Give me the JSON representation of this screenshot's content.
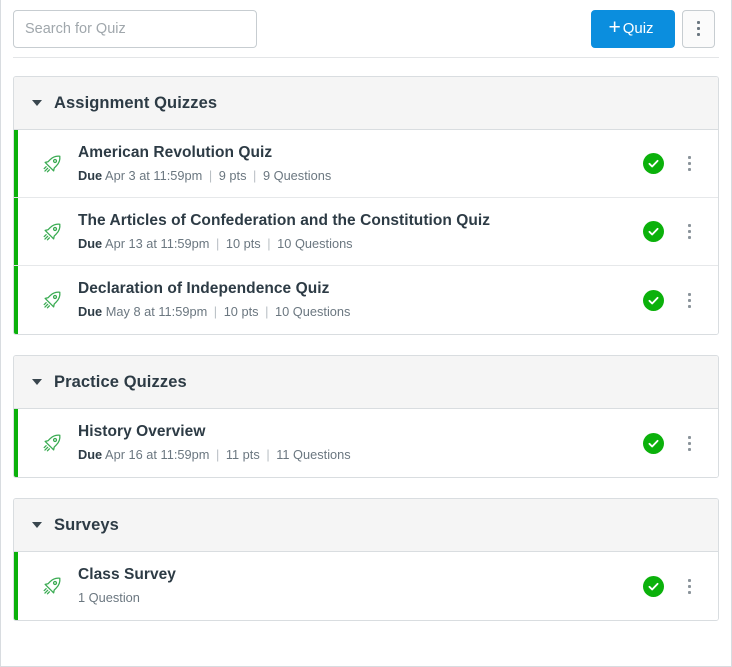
{
  "toolbar": {
    "search_placeholder": "Search for Quiz",
    "search_value": "",
    "add_quiz_label": "Quiz",
    "add_quiz_plus": "+",
    "kebab_name": "more-options"
  },
  "groups": [
    {
      "title": "Assignment Quizzes",
      "rows": [
        {
          "title": "American Revolution Quiz",
          "due_label": "Due",
          "due_value": "Apr 3 at 11:59pm",
          "points": "9 pts",
          "questions": "9 Questions",
          "published": true
        },
        {
          "title": "The Articles of Confederation and the Constitution Quiz",
          "due_label": "Due",
          "due_value": "Apr 13 at 11:59pm",
          "points": "10 pts",
          "questions": "10 Questions",
          "published": true
        },
        {
          "title": "Declaration of Independence Quiz",
          "due_label": "Due",
          "due_value": "May 8 at 11:59pm",
          "points": "10 pts",
          "questions": "10 Questions",
          "published": true
        }
      ]
    },
    {
      "title": "Practice Quizzes",
      "rows": [
        {
          "title": "History Overview",
          "due_label": "Due",
          "due_value": "Apr 16 at 11:59pm",
          "points": "11 pts",
          "questions": "11 Questions",
          "published": true
        }
      ]
    },
    {
      "title": "Surveys",
      "rows": [
        {
          "title": "Class Survey",
          "due_label": "",
          "due_value": "",
          "points": "",
          "questions": "1 Question",
          "published": true
        }
      ]
    }
  ],
  "colors": {
    "accent_blue": "#0b8ede",
    "published_green": "#0bb10b",
    "rocket_green": "#3aab52",
    "text_dark": "#2d3b45",
    "text_muted": "#6b7780"
  },
  "icons": {
    "rocket": "rocket-icon",
    "published": "published-check-icon",
    "kebab": "kebab-menu-icon",
    "caret": "chevron-down-icon"
  }
}
